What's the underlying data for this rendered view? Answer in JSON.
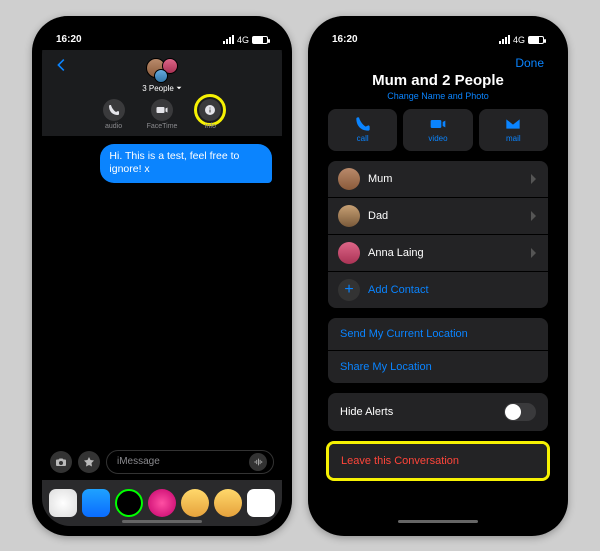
{
  "status": {
    "time": "16:20",
    "network": "4G"
  },
  "left": {
    "group_label": "3 People",
    "actions": {
      "audio": "audio",
      "facetime": "FaceTime",
      "info": "info"
    },
    "message": "Hi. This is a test, feel free to ignore! x",
    "compose_placeholder": "iMessage"
  },
  "right": {
    "done": "Done",
    "title": "Mum and 2 People",
    "change": "Change Name and Photo",
    "action_buttons": {
      "call": "call",
      "video": "video",
      "mail": "mail"
    },
    "members": [
      "Mum",
      "Dad",
      "Anna Laing"
    ],
    "add_contact": "Add Contact",
    "send_location": "Send My Current Location",
    "share_location": "Share My Location",
    "hide_alerts": "Hide Alerts",
    "leave": "Leave this Conversation"
  }
}
